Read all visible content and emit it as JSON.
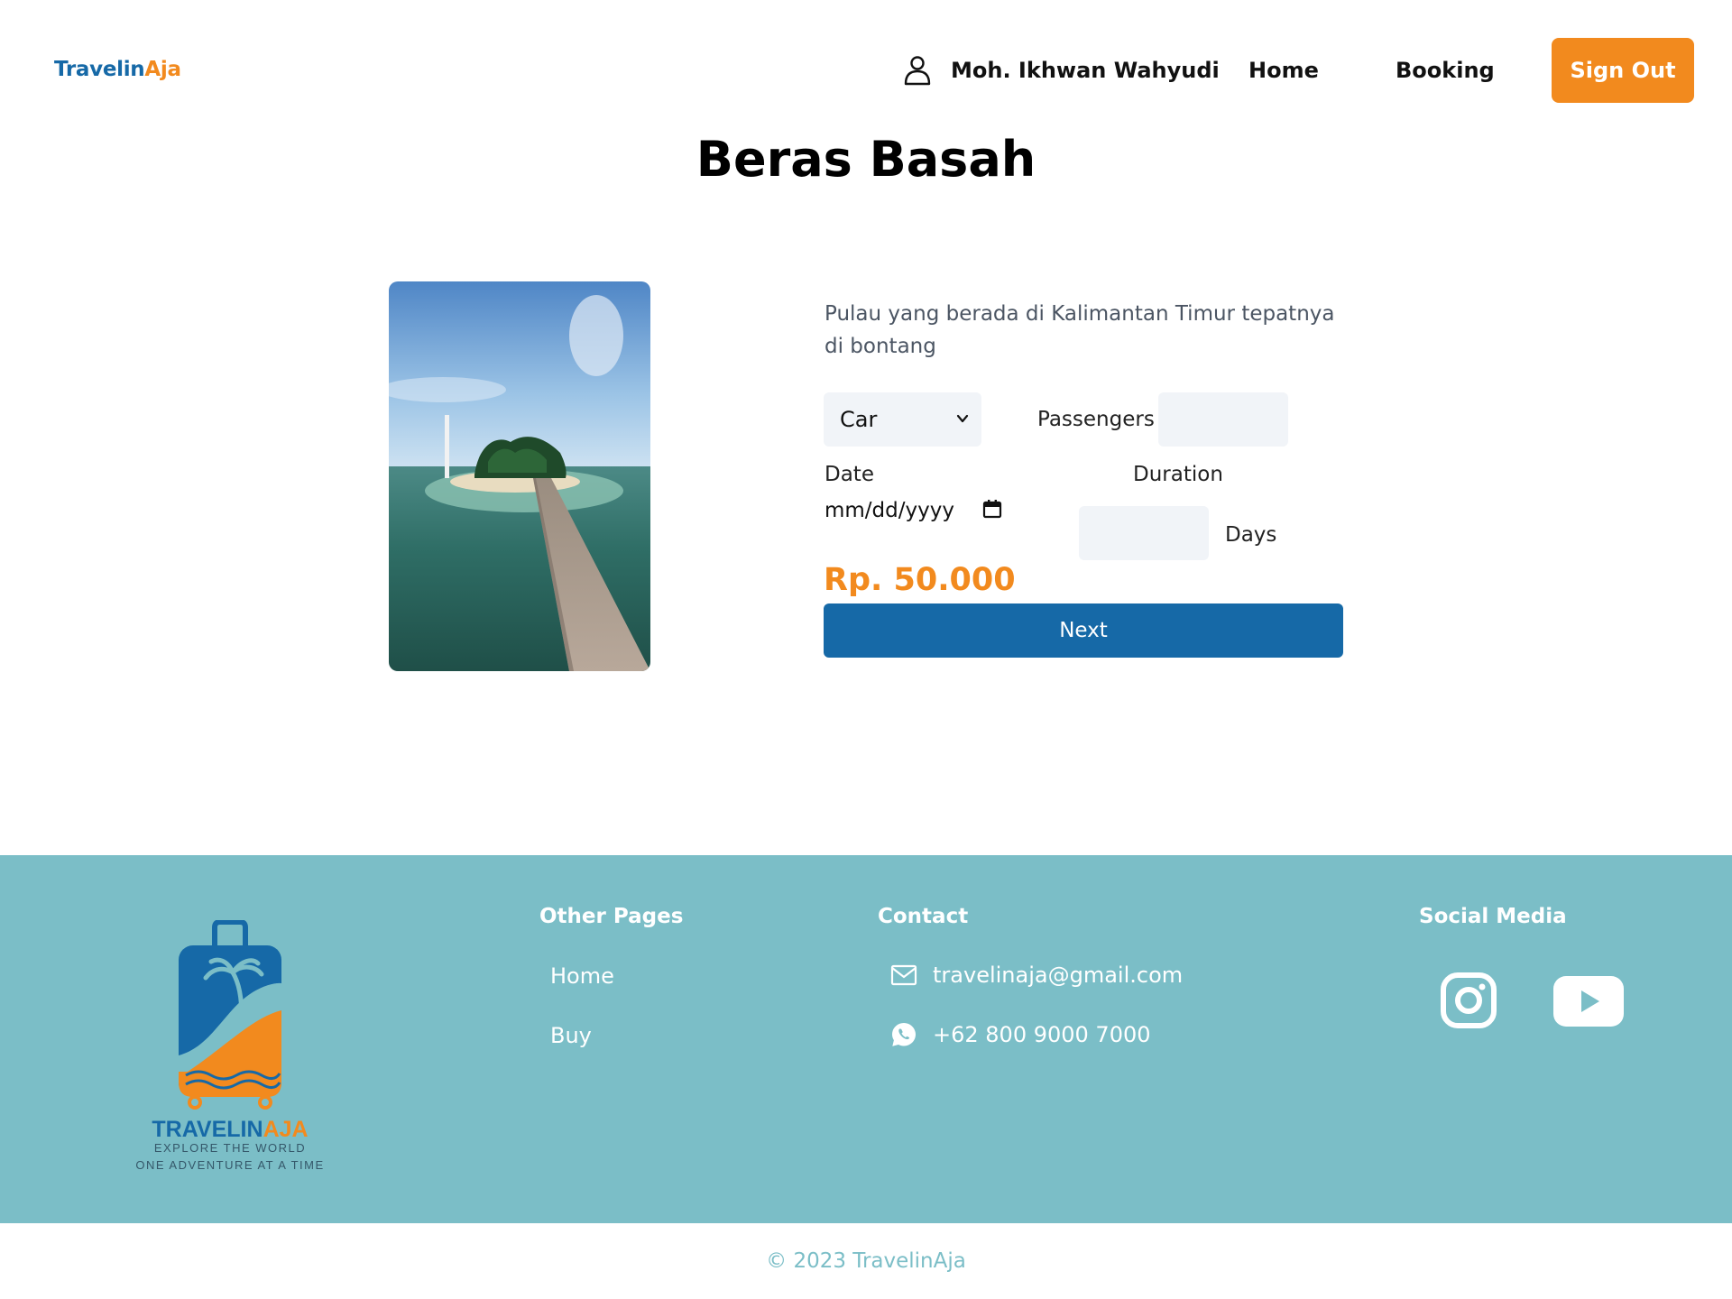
{
  "navbar": {
    "brand_part1": "Travelin",
    "brand_part2": "Aja",
    "user_name": "Moh. Ikhwan Wahyudi",
    "links": [
      "Home",
      "Booking"
    ],
    "sign_out_label": "Sign Out"
  },
  "destination": {
    "title": "Beras Basah",
    "description": "Pulau yang berada di Kalimantan Timur tepatnya di bontang",
    "image_icon": "island-photo"
  },
  "form": {
    "vehicle_selected": "Car",
    "passengers_label": "Passengers",
    "passengers_value": "",
    "date_label": "Date",
    "date_placeholder": "mm/dd/yyyy",
    "duration_label": "Duration",
    "duration_value": "",
    "days_label": "Days",
    "price": "Rp. 50.000",
    "next_label": "Next"
  },
  "footer": {
    "logo_text_part1": "TRAVELIN",
    "logo_text_part2": "AJA",
    "logo_tagline1": "EXPLORE THE WORLD",
    "logo_tagline2": "ONE ADVENTURE AT A TIME",
    "other_pages_heading": "Other Pages",
    "other_pages": [
      "Home",
      "Buy"
    ],
    "contact_heading": "Contact",
    "email": "travelinaja@gmail.com",
    "phone": "+62 800 9000 7000",
    "social_heading": "Social Media",
    "social_icons": [
      "instagram-icon",
      "youtube-icon"
    ]
  },
  "copyright": "© 2023 TravelinAja",
  "colors": {
    "brand_blue": "#1669a7",
    "brand_orange": "#f28a1e",
    "footer_bg": "#7bbec7",
    "input_bg": "#f1f4f8"
  }
}
